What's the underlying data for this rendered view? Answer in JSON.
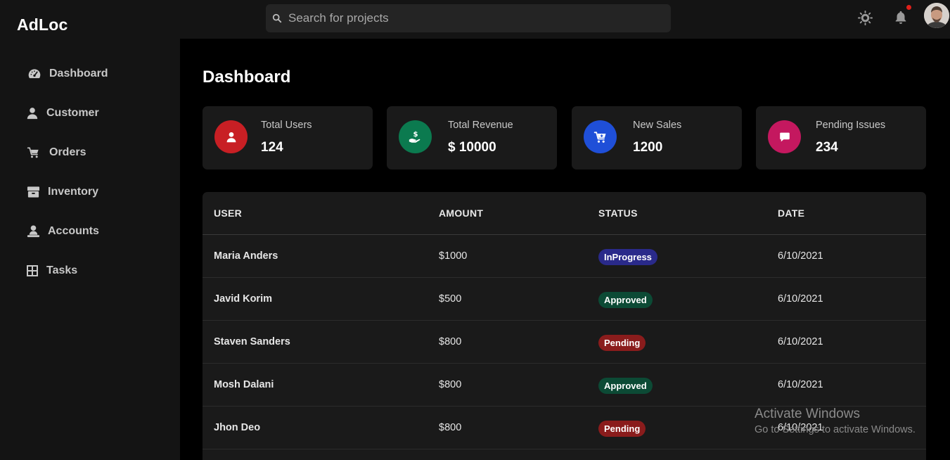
{
  "app": {
    "brand": "AdLoc"
  },
  "search": {
    "placeholder": "Search for projects",
    "icon": "search-icon"
  },
  "topbar": {
    "icons": [
      "brightness-icon",
      "bell-icon"
    ],
    "notification_dot_color": "#e0201a"
  },
  "sidebar": {
    "items": [
      {
        "label": "Dashboard",
        "icon": "speedometer-icon"
      },
      {
        "label": "Customer",
        "icon": "user-icon"
      },
      {
        "label": "Orders",
        "icon": "cart-icon"
      },
      {
        "label": "Inventory",
        "icon": "box-icon"
      },
      {
        "label": "Accounts",
        "icon": "person-desk-icon"
      },
      {
        "label": "Tasks",
        "icon": "grid-icon"
      }
    ]
  },
  "main": {
    "title": "Dashboard"
  },
  "cards": [
    {
      "label": "Total Users",
      "value": "124",
      "icon": "user-icon",
      "color": "#c81f24"
    },
    {
      "label": "Total Revenue",
      "value": "$ 10000",
      "icon": "hand-dollar-icon",
      "color": "#0b7a4f"
    },
    {
      "label": "New Sales",
      "value": "1200",
      "icon": "cart-icon",
      "color": "#1f4fd8"
    },
    {
      "label": "Pending Issues",
      "value": "234",
      "icon": "chat-icon",
      "color": "#c4185f"
    }
  ],
  "table": {
    "headers": [
      "USER",
      "AMOUNT",
      "STATUS",
      "DATE"
    ],
    "rows": [
      {
        "user": "Maria Anders",
        "amount": "$1000",
        "status": "InProgress",
        "date": "6/10/2021"
      },
      {
        "user": "Javid Korim",
        "amount": "$500",
        "status": "Approved",
        "date": "6/10/2021"
      },
      {
        "user": "Staven Sanders",
        "amount": "$800",
        "status": "Pending",
        "date": "6/10/2021"
      },
      {
        "user": "Mosh Dalani",
        "amount": "$800",
        "status": "Approved",
        "date": "6/10/2021"
      },
      {
        "user": "Jhon Deo",
        "amount": "$800",
        "status": "Pending",
        "date": "6/10/2021"
      }
    ]
  },
  "status_colors": {
    "InProgress": "#2a2a8a",
    "Approved": "#0c4a35",
    "Pending": "#8a1c1c"
  },
  "watermark": {
    "line1": "Activate Windows",
    "line2": "Go to Settings to activate Windows."
  }
}
